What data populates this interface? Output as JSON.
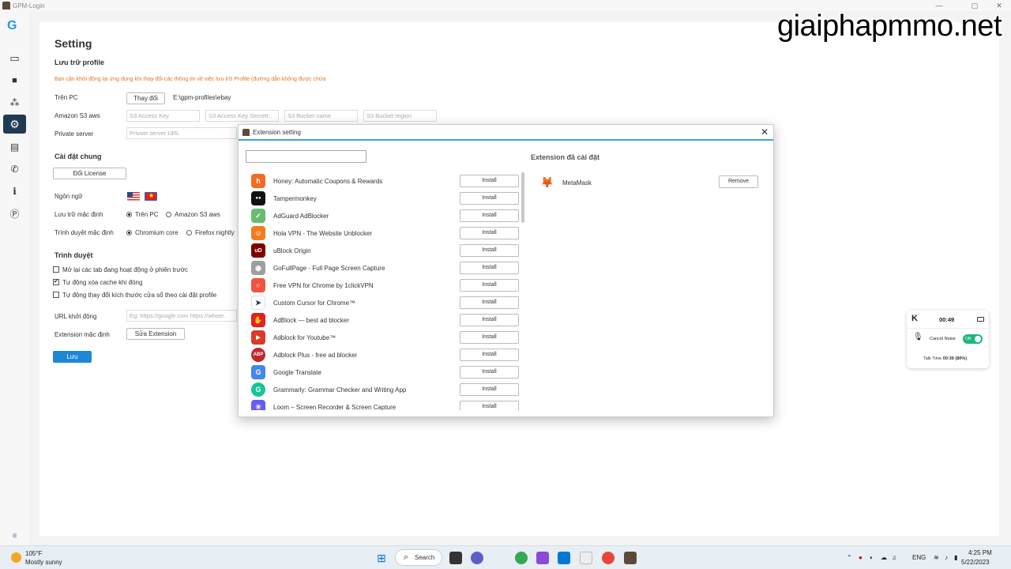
{
  "window": {
    "title": "GPM-Login",
    "minimize": "—",
    "maximize": "▢",
    "close": "✕"
  },
  "watermark": "giaiphapmmo.net",
  "sidebar": {
    "logo": "G",
    "items": [
      {
        "icon": "credit-card-icon",
        "glyph": "▭"
      },
      {
        "icon": "folder-icon",
        "glyph": "■"
      },
      {
        "icon": "cubes-icon",
        "glyph": "⁂"
      },
      {
        "icon": "gear-icon",
        "glyph": "⚙"
      },
      {
        "icon": "book-icon",
        "glyph": "▤"
      },
      {
        "icon": "phone-icon",
        "glyph": "✆"
      },
      {
        "icon": "info-icon",
        "glyph": "ℹ"
      },
      {
        "icon": "p-icon",
        "glyph": "Ⓟ"
      }
    ],
    "bottom_icon": "≡"
  },
  "settings": {
    "title": "Setting",
    "storage_section": "Lưu trữ profile",
    "warning": "Bạn cần khởi động lại ứng dụng khi thay đổi các thông tin về việc lưu trữ Profile (đường dẫn không được chứa",
    "on_pc_label": "Trên PC",
    "change_button": "Thay đổi",
    "path": "E:\\gpm-profiles\\ebay",
    "s3_label": "Amazon S3 aws",
    "s3_access_key": "S3 Access Key",
    "s3_access_secret": "S3 Access Key Secrett",
    "s3_bucket_name": "S3 Bucket name",
    "s3_bucket_region": "S3 Bucket region",
    "private_server_label": "Private server",
    "private_server_placeholder": "Private server URL",
    "general_section": "Cài đặt chung",
    "change_license": "Đổi License",
    "language_label": "Ngôn ngữ",
    "default_storage_label": "Lưu trữ mặc định",
    "storage_opt_pc": "Trên PC",
    "storage_opt_s3": "Amazon S3 aws",
    "default_browser_label": "Trình duyệt mặc định",
    "browser_opt_chromium": "Chromium core",
    "browser_opt_firefox": "Firefox nightly",
    "browser_section": "Trình duyệt",
    "chk_reopen_tabs": "Mở lại các tab đang hoạt động ở phiên trước",
    "chk_clear_cache": "Tự động xóa cache khi đóng",
    "chk_resize_window": "Tự động thay đổi kích thước cửa sổ theo cài đặt profile",
    "startup_url_label": "URL khởi động",
    "startup_url_placeholder": "Eg: https://google.com https://whoer.",
    "default_ext_label": "Extension mặc định",
    "edit_ext_button": "Sửa Extension",
    "save_button": "Lưu"
  },
  "dialog": {
    "title": "Extension setting",
    "close": "✕",
    "installed_title": "Extension đã cài đặt",
    "install_label": "Install",
    "remove_label": "Remove",
    "extensions": [
      {
        "name": "Honey: Automatic Coupons & Rewards",
        "color": "#f26c21",
        "glyph": "h"
      },
      {
        "name": "Tampermonkey",
        "color": "#111111",
        "glyph": "●●"
      },
      {
        "name": "AdGuard AdBlocker",
        "color": "#68bc71",
        "glyph": "✓"
      },
      {
        "name": "Hola VPN - The Website Unblocker",
        "color": "#f47c20",
        "glyph": "☺"
      },
      {
        "name": "uBlock Origin",
        "color": "#800000",
        "glyph": "uD"
      },
      {
        "name": "GoFullPage - Full Page Screen Capture",
        "color": "#9e9e9e",
        "glyph": "◉"
      },
      {
        "name": "Free VPN for Chrome by 1clickVPN",
        "color": "#f0533f",
        "glyph": "○"
      },
      {
        "name": "Custom Cursor for Chrome™",
        "color": "#ffffff",
        "glyph": "➤"
      },
      {
        "name": "AdBlock — best ad blocker",
        "color": "#e4201f",
        "glyph": "✋"
      },
      {
        "name": "Adblock for Youtube™",
        "color": "#d93a2b",
        "glyph": "▶"
      },
      {
        "name": "Adblock Plus - free ad blocker",
        "color": "#c1272d",
        "glyph": "ABP"
      },
      {
        "name": "Google Translate",
        "color": "#4285f4",
        "glyph": "G"
      },
      {
        "name": "Grammarly: Grammar Checker and Writing App",
        "color": "#15c39a",
        "glyph": "G"
      },
      {
        "name": "Loom – Screen Recorder & Screen Capture",
        "color": "#625df5",
        "glyph": "✳"
      }
    ],
    "installed": [
      {
        "name": "MetaMask",
        "color": "#f6851b",
        "glyph": "🦊"
      }
    ]
  },
  "widget": {
    "time": "00:49",
    "noise_label": "Cancel Noise",
    "toggle": "ON",
    "talk_label": "Talk Time",
    "talk_value": "00:39 (80%)"
  },
  "taskbar": {
    "temp": "105°F",
    "weather": "Mostly sunny",
    "search": "Search",
    "lang": "ENG",
    "time": "4:25 PM",
    "date": "5/22/2023"
  }
}
